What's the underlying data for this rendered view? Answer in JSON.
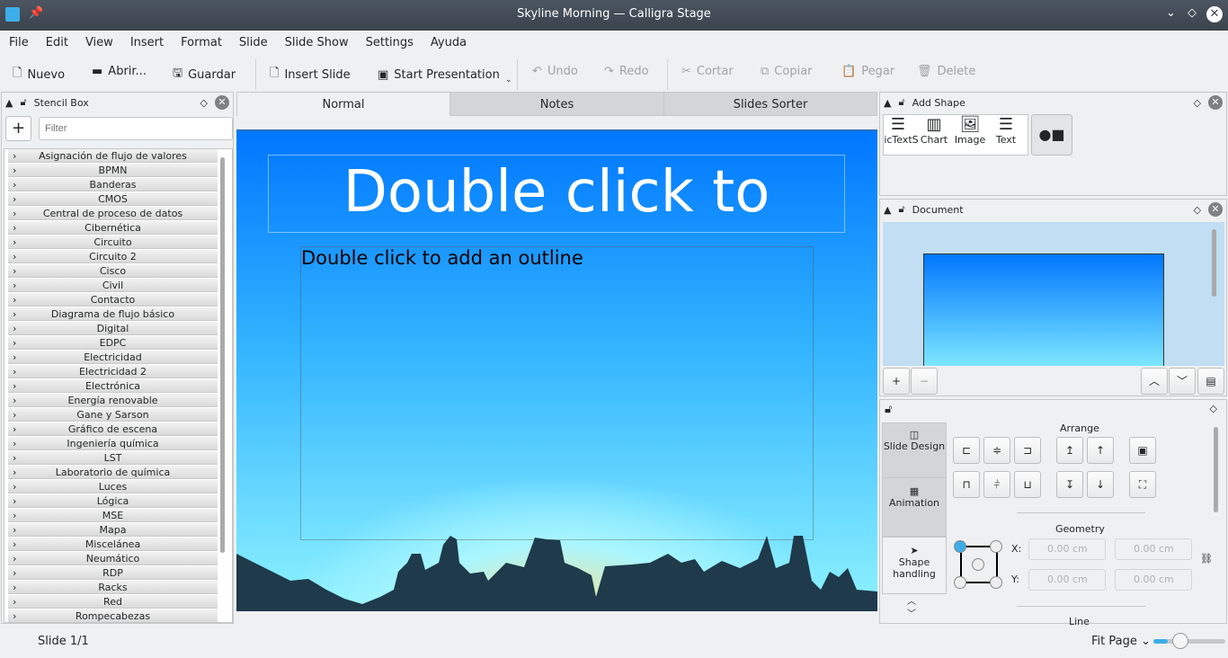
{
  "window": {
    "title": "Skyline Morning — Calligra Stage"
  },
  "menu": [
    "File",
    "Edit",
    "View",
    "Insert",
    "Format",
    "Slide",
    "Slide Show",
    "Settings",
    "Ayuda"
  ],
  "toolbar": {
    "nuevo": "Nuevo",
    "abrir": "Abrir...",
    "guardar": "Guardar",
    "insert_slide": "Insert Slide",
    "start_presentation": "Start Presentation",
    "undo": "Undo",
    "redo": "Redo",
    "cortar": "Cortar",
    "copiar": "Copiar",
    "pegar": "Pegar",
    "delete": "Delete"
  },
  "stencil_box": {
    "title": "Stencil Box",
    "filter_placeholder": "Filter",
    "add": "+",
    "items": [
      "Asignación de flujo de valores",
      "BPMN",
      "Banderas",
      "CMOS",
      "Central de proceso de datos",
      "Cibernética",
      "Circuito",
      "Circuito 2",
      "Cisco",
      "Civil",
      "Contacto",
      "Diagrama de flujo básico",
      "Digital",
      "EDPC",
      "Electricidad",
      "Electricidad 2",
      "Electrónica",
      "Energía renovable",
      "Gane y Sarson",
      "Gráfico de escena",
      "Ingeniería química",
      "LST",
      "Laboratorio de química",
      "Luces",
      "Lógica",
      "MSE",
      "Mapa",
      "Miscelánea",
      "Neumático",
      "RDP",
      "Racks",
      "Red",
      "Rompecabezas"
    ]
  },
  "tabs": [
    "Normal",
    "Notes",
    "Slides Sorter"
  ],
  "slide": {
    "title": "Double click to",
    "outline": "Double click to add an outline"
  },
  "add_shape": {
    "title": "Add Shape",
    "items": [
      "ticTextS",
      "Chart",
      "Image",
      "Text"
    ]
  },
  "document": {
    "title": "Document"
  },
  "tool_options": {
    "side_tabs": [
      "Slide Design",
      "Animation",
      "Shape handling"
    ],
    "arrange": "Arrange",
    "geometry": "Geometry",
    "line": "Line",
    "x_label": "X:",
    "y_label": "Y:",
    "x": "0.00 cm",
    "y": "0.00 cm",
    "w": "0.00 cm",
    "h": "0.00 cm"
  },
  "status": {
    "slide": "Slide 1/1",
    "zoom": "Fit Page",
    "zoom_slider": 0.25
  },
  "colors": {
    "slide_top": "#0077ff",
    "slide_bottom": "#7ff0ff",
    "skyline": "#1e3a4b",
    "accent": "#3daee9"
  }
}
